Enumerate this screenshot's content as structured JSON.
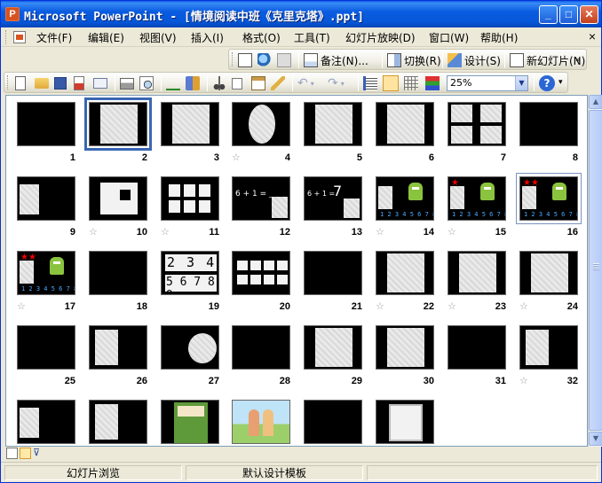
{
  "window": {
    "title": "Microsoft PowerPoint - [情境阅读中班《克里克塔》.ppt]",
    "icon": "powerpoint-app-icon"
  },
  "window_controls": {
    "minimize": "_",
    "maximize": "□",
    "close": "✕"
  },
  "menu": {
    "items": [
      {
        "label": "文件(F)"
      },
      {
        "label": "编辑(E)"
      },
      {
        "label": "视图(V)"
      },
      {
        "label": "插入(I)"
      },
      {
        "label": "格式(O)"
      },
      {
        "label": "工具(T)"
      },
      {
        "label": "幻灯片放映(D)"
      },
      {
        "label": "窗口(W)"
      },
      {
        "label": "帮助(H)"
      }
    ],
    "close_doc": "×"
  },
  "slide_sorter_toolbar": {
    "notes_label": "备注(N)...",
    "transition_label": "切换(R)",
    "design_label": "设计(S)",
    "new_slide_label": "新幻灯片(N)"
  },
  "standard_toolbar": {
    "zoom_value": "25%",
    "icons": [
      "new-icon",
      "open-icon",
      "save-icon",
      "permission-icon",
      "email-icon",
      "print-icon",
      "print-preview-icon",
      "spelling-icon",
      "research-icon",
      "cut-icon",
      "copy-icon",
      "paste-icon",
      "format-painter-icon",
      "undo-icon",
      "redo-icon",
      "expand-icon",
      "show-formatting-icon",
      "grid-icon",
      "color-grayscale-icon",
      "help-icon"
    ]
  },
  "slides": [
    {
      "num": "1"
    },
    {
      "num": "2"
    },
    {
      "num": "3"
    },
    {
      "num": "4"
    },
    {
      "num": "5"
    },
    {
      "num": "6"
    },
    {
      "num": "7"
    },
    {
      "num": "8"
    },
    {
      "num": "9"
    },
    {
      "num": "10"
    },
    {
      "num": "11"
    },
    {
      "num": "12"
    },
    {
      "num": "13"
    },
    {
      "num": "14"
    },
    {
      "num": "15"
    },
    {
      "num": "16"
    },
    {
      "num": "17"
    },
    {
      "num": "18"
    },
    {
      "num": "19"
    },
    {
      "num": "20"
    },
    {
      "num": "21"
    },
    {
      "num": "22"
    },
    {
      "num": "23"
    },
    {
      "num": "24"
    },
    {
      "num": "25"
    },
    {
      "num": "26"
    },
    {
      "num": "27"
    },
    {
      "num": "28"
    },
    {
      "num": "29"
    },
    {
      "num": "30"
    },
    {
      "num": "31"
    },
    {
      "num": "32"
    },
    {
      "num": ""
    },
    {
      "num": ""
    },
    {
      "num": ""
    },
    {
      "num": ""
    },
    {
      "num": ""
    },
    {
      "num": ""
    }
  ],
  "slide_text": {
    "s12": "6 + 1 = __",
    "s13_eq": "6 + 1 =",
    "s13_ans": "7",
    "s19_top": "2 3 4",
    "s19_bottom": "5 6 7 8 9",
    "s14_digits": "1 2 3 4 5 6 7 8"
  },
  "statusbar": {
    "view": "幻灯片浏览",
    "template": "默认设计模板"
  },
  "colors": {
    "titlebar": "#0a5ce0",
    "selection": "#3a66b3",
    "slide_bg": "#000000"
  }
}
